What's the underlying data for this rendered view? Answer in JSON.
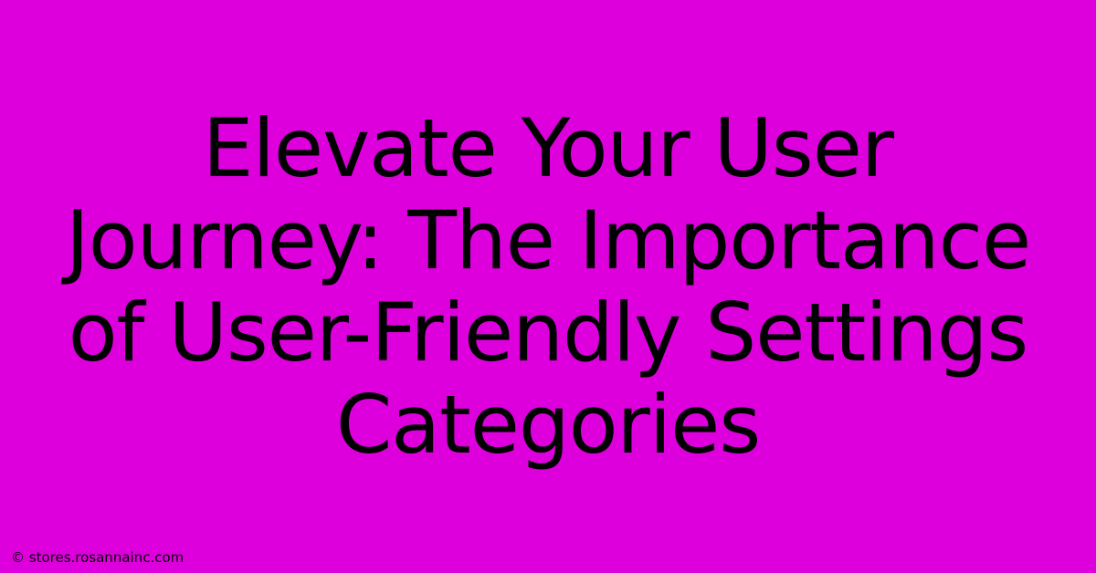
{
  "title": "Elevate Your User Journey: The Importance of User-Friendly Settings Categories",
  "attribution": "© stores.rosannainc.com",
  "colors": {
    "background": "#DD00DD",
    "text": "#000000"
  }
}
